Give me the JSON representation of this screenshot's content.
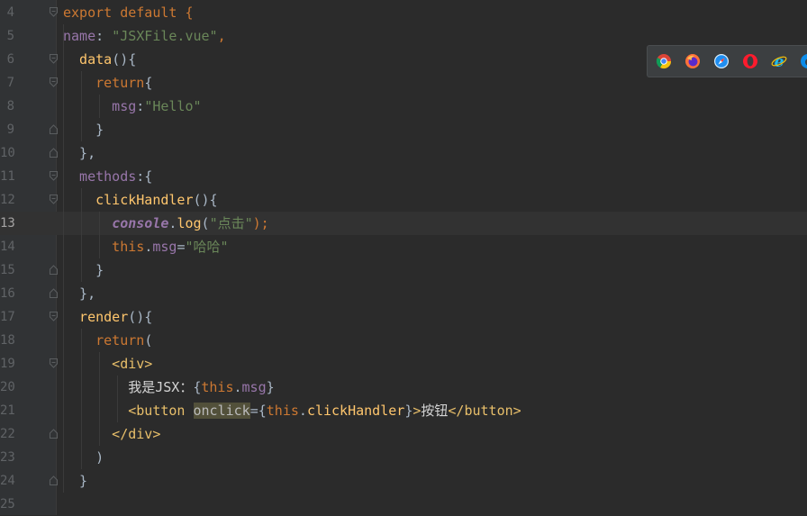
{
  "editor": {
    "current_line": "13",
    "lines": [
      {
        "num": "4",
        "fold": "open",
        "tokens": [
          {
            "t": "export default {",
            "c": "kw"
          }
        ]
      },
      {
        "num": "5",
        "fold": "",
        "tokens": [
          {
            "t": "name",
            "c": "prop"
          },
          {
            "t": ": ",
            "c": "plain"
          },
          {
            "t": "\"JSXFile.vue\"",
            "c": "str"
          },
          {
            "t": ",",
            "c": "kw"
          }
        ]
      },
      {
        "num": "6",
        "fold": "open",
        "tokens": [
          {
            "t": "  data",
            "c": "fn"
          },
          {
            "t": "(){",
            "c": "plain"
          }
        ]
      },
      {
        "num": "7",
        "fold": "open",
        "tokens": [
          {
            "t": "    return",
            "c": "kw"
          },
          {
            "t": "{",
            "c": "plain"
          }
        ]
      },
      {
        "num": "8",
        "fold": "",
        "tokens": [
          {
            "t": "      msg",
            "c": "prop"
          },
          {
            "t": ":",
            "c": "plain"
          },
          {
            "t": "\"Hello\"",
            "c": "str"
          }
        ]
      },
      {
        "num": "9",
        "fold": "close",
        "tokens": [
          {
            "t": "    }",
            "c": "plain"
          }
        ]
      },
      {
        "num": "10",
        "fold": "close",
        "tokens": [
          {
            "t": "  },",
            "c": "plain"
          }
        ]
      },
      {
        "num": "11",
        "fold": "open",
        "tokens": [
          {
            "t": "  methods",
            "c": "prop"
          },
          {
            "t": ":{",
            "c": "plain"
          }
        ]
      },
      {
        "num": "12",
        "fold": "open",
        "tokens": [
          {
            "t": "    clickHandler",
            "c": "fn"
          },
          {
            "t": "(){",
            "c": "plain"
          }
        ]
      },
      {
        "num": "13",
        "fold": "",
        "tokens": [
          {
            "t": "      ",
            "c": "plain"
          },
          {
            "t": "console",
            "c": "console"
          },
          {
            "t": ".",
            "c": "plain"
          },
          {
            "t": "log",
            "c": "fn"
          },
          {
            "t": "(",
            "c": "plain"
          },
          {
            "t": "\"点击\"",
            "c": "str"
          },
          {
            "t": ");",
            "c": "kw"
          }
        ]
      },
      {
        "num": "14",
        "fold": "",
        "tokens": [
          {
            "t": "      this",
            "c": "kw"
          },
          {
            "t": ".",
            "c": "plain"
          },
          {
            "t": "msg",
            "c": "prop"
          },
          {
            "t": "=",
            "c": "plain"
          },
          {
            "t": "\"哈哈\"",
            "c": "str"
          }
        ]
      },
      {
        "num": "15",
        "fold": "close",
        "tokens": [
          {
            "t": "    }",
            "c": "plain"
          }
        ]
      },
      {
        "num": "16",
        "fold": "close",
        "tokens": [
          {
            "t": "  },",
            "c": "plain"
          }
        ]
      },
      {
        "num": "17",
        "fold": "open",
        "tokens": [
          {
            "t": "  render",
            "c": "fn"
          },
          {
            "t": "(){",
            "c": "plain"
          }
        ]
      },
      {
        "num": "18",
        "fold": "",
        "tokens": [
          {
            "t": "    return",
            "c": "kw"
          },
          {
            "t": "(",
            "c": "plain"
          }
        ]
      },
      {
        "num": "19",
        "fold": "open",
        "tokens": [
          {
            "t": "      <div>",
            "c": "tag"
          }
        ]
      },
      {
        "num": "20",
        "fold": "",
        "tokens": [
          {
            "t": "        我是JSX：",
            "c": "txt"
          },
          {
            "t": "{",
            "c": "plain"
          },
          {
            "t": "this",
            "c": "kw"
          },
          {
            "t": ".",
            "c": "plain"
          },
          {
            "t": "msg",
            "c": "prop"
          },
          {
            "t": "}",
            "c": "plain"
          }
        ]
      },
      {
        "num": "21",
        "fold": "",
        "tokens": [
          {
            "t": "        <button ",
            "c": "tag"
          },
          {
            "t": "onclick",
            "c": "attr hl"
          },
          {
            "t": "={",
            "c": "plain"
          },
          {
            "t": "this",
            "c": "kw"
          },
          {
            "t": ".",
            "c": "plain"
          },
          {
            "t": "clickHandler",
            "c": "fn"
          },
          {
            "t": "}",
            "c": "plain"
          },
          {
            "t": ">",
            "c": "tag"
          },
          {
            "t": "按钮",
            "c": "txt"
          },
          {
            "t": "</button>",
            "c": "tag"
          }
        ]
      },
      {
        "num": "22",
        "fold": "close",
        "tokens": [
          {
            "t": "      </div>",
            "c": "tag"
          }
        ]
      },
      {
        "num": "23",
        "fold": "",
        "tokens": [
          {
            "t": "    )",
            "c": "plain"
          }
        ]
      },
      {
        "num": "24",
        "fold": "close",
        "tokens": [
          {
            "t": "  }",
            "c": "plain"
          }
        ]
      },
      {
        "num": "25",
        "fold": "",
        "tokens": []
      }
    ]
  },
  "browser_bar": {
    "icons": [
      "chrome-icon",
      "firefox-icon",
      "safari-icon",
      "opera-icon",
      "internet-explorer-icon",
      "edge-icon"
    ]
  },
  "colors": {
    "background": "#2b2b2b",
    "keyword": "#cc7832",
    "string": "#6a8759",
    "property": "#9876aa",
    "function": "#ffc66d",
    "tag": "#e8bf6a",
    "line_number": "#606366"
  }
}
